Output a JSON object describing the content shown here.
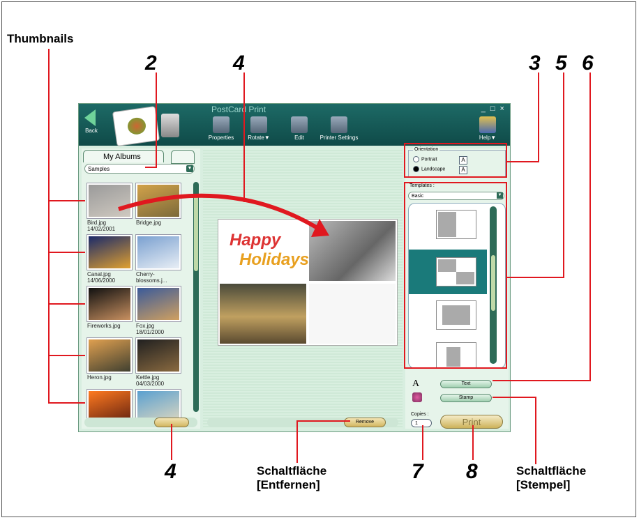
{
  "callouts": {
    "thumbnails": "Thumbnails",
    "n2": "2",
    "n4_top": "4",
    "n3": "3",
    "n5": "5",
    "n6": "6",
    "n4_bottom": "4",
    "n7": "7",
    "n8": "8",
    "remove_caption_line1": "Schaltfläche",
    "remove_caption_line2": "[Entfernen]",
    "stamp_caption_line1": "Schaltfläche",
    "stamp_caption_line2": "[Stempel]"
  },
  "window": {
    "title": "PostCard Print",
    "controls": "_ □ ×",
    "back_label": "Back",
    "help_label": "Help▼",
    "toolbar": [
      {
        "label": "Properties"
      },
      {
        "label": "Rotate▼"
      },
      {
        "label": "Edit"
      },
      {
        "label": "Printer Settings"
      }
    ]
  },
  "left_panel": {
    "tab_label": "My Albums",
    "album_select": "Samples",
    "thumbnails": [
      {
        "name": "Bird.jpg",
        "date": "14/02/2001",
        "colors": [
          "#9a9a9a",
          "#cfc9c0"
        ]
      },
      {
        "name": "Bridge.jpg",
        "date": "",
        "colors": [
          "#d2a24a",
          "#7c6a3a"
        ]
      },
      {
        "name": "Canal.jpg",
        "date": "14/06/2000",
        "colors": [
          "#1a2a6a",
          "#e0a030"
        ]
      },
      {
        "name": "Cherry-blossoms.j...",
        "date": "",
        "colors": [
          "#7aa0d0",
          "#e8eef5"
        ]
      },
      {
        "name": "Fireworks.jpg",
        "date": "",
        "colors": [
          "#101010",
          "#c89060"
        ]
      },
      {
        "name": "Fox.jpg",
        "date": "18/01/2000",
        "colors": [
          "#3a5a9a",
          "#d0a060"
        ]
      },
      {
        "name": "Heron.jpg",
        "date": "",
        "colors": [
          "#e0a050",
          "#404030"
        ]
      },
      {
        "name": "Kettle.jpg",
        "date": "04/03/2000",
        "colors": [
          "#202020",
          "#8a6a40"
        ]
      },
      {
        "name": "",
        "date": "",
        "colors": [
          "#ff7a20",
          "#602010"
        ]
      },
      {
        "name": "",
        "date": "",
        "colors": [
          "#5aa0d0",
          "#e0d8c0"
        ]
      }
    ]
  },
  "center": {
    "card_text_line1": "Happy",
    "card_text_line2": "Holidays",
    "remove_label": "Remove"
  },
  "right_panel": {
    "orientation_label": "Orientation",
    "portrait_label": "Portrait",
    "landscape_label": "Landscape",
    "selected_orientation": "Landscape",
    "templates_label": "Templates :",
    "templates_select": "Basic",
    "text_button": "Text",
    "stamp_button": "Stamp",
    "copies_label": "Copies :",
    "copies_value": "1",
    "print_label": "Print"
  }
}
